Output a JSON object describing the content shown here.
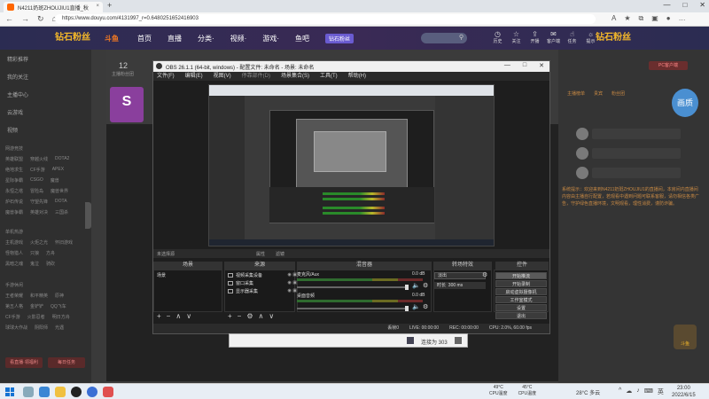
{
  "browser": {
    "tab_title": "N4211奶斑ZHOUJIU1直播_秋",
    "new_tab": "+",
    "window_controls": [
      "—",
      "□",
      "✕"
    ],
    "url": "https://www.douyu.com/4131997_r=0.6480251652416903",
    "nav_icons": [
      "back-icon",
      "forward-icon",
      "refresh-icon",
      "home-icon"
    ],
    "tool_icons": [
      "read-aloud-icon",
      "favorite-icon",
      "extensions-icon",
      "collections-icon",
      "profile-icon",
      "menu-icon"
    ]
  },
  "site": {
    "logo": "钻石粉丝",
    "logo_sub": "斗鱼",
    "nav": [
      "首页",
      "直播",
      "分类·",
      "视频·",
      "游戏·",
      "鱼吧",
      "钻石粉丝",
      "可爆宝石"
    ],
    "header_icons": [
      {
        "icon": "clock-icon",
        "label": "历史"
      },
      {
        "icon": "star-icon",
        "label": "关注"
      },
      {
        "icon": "upload-icon",
        "label": "开播"
      },
      {
        "icon": "mail-icon",
        "label": "客户端"
      },
      {
        "icon": "hand-icon",
        "label": "任务"
      },
      {
        "icon": "bulb-icon",
        "label": "提示"
      }
    ],
    "logo_right": "钻石粉丝"
  },
  "sidebar": {
    "items": [
      "精彩推荐",
      "我的关注",
      "主播中心",
      "云游戏",
      "视频"
    ],
    "group1_title": "网游竞技",
    "group1_rows": [
      [
        "英雄联盟",
        "穿越火线",
        "DOTA2"
      ],
      [
        "绝地求生",
        "CF手游",
        "APEX"
      ],
      [
        "星际争霸",
        "CSGO",
        "魔兽"
      ],
      [
        "永恒之塔",
        "冒险岛",
        "魔兽世界"
      ],
      [
        "炉石传说",
        "守望先锋",
        "DOTA"
      ],
      [
        "魔兽争霸",
        "英雄对决",
        "三国杀"
      ]
    ],
    "group2_title": "单机热游",
    "group2_rows": [
      [
        "主机游戏",
        "火炬之光",
        "怀旧游戏"
      ],
      [
        "怪物猎人",
        "只狼",
        "方舟"
      ],
      [
        "黑暗之魂",
        "鬼泣",
        "骑砍"
      ]
    ],
    "group3_title": "手游休闲",
    "group3_rows": [
      [
        "王者荣耀",
        "和平精英",
        "原神"
      ],
      [
        "第五人格",
        "金铲铲",
        "QQ飞车"
      ],
      [
        "CF手游",
        "火影忍者",
        "明日方舟"
      ],
      [
        "球球大作战",
        "阴阳师",
        "光遇"
      ]
    ],
    "btn_left": "看直播·领福利",
    "btn_right": "每日任务"
  },
  "stream": {
    "count": "12",
    "count_label": "主播粉丝团"
  },
  "right_panel": {
    "top_button": "PC客户端",
    "tabs": [
      "主播榜单",
      "贵宾",
      "粉丝团"
    ],
    "bird": "画质",
    "notice": "系统提示：欢迎来到N4211奶斑ZHOUJIU1的直播间，本房间内直播间内容由主播自行配置，若观看中遇到问题可联系客服，请勿相信各类广告，守护绿色直播环境，文明观看，理性消费，谨防诈骗。",
    "mascot": "斗鱼"
  },
  "obs": {
    "title": "OBS 26.1.1 (64-bit, windows) - 配置文件: 未命名 - 场景: 未命名",
    "menu": [
      "文件(F)",
      "编辑(E)",
      "视图(V)",
      "停靠部件(D)",
      "场景集合(S)",
      "工具(T)",
      "帮助(H)"
    ],
    "no_source": "未选择源",
    "properties": "属性",
    "filters": "滤镜",
    "docks": {
      "scenes": "场景",
      "sources": "来源",
      "mixer": "混音器",
      "transitions": "转场特效",
      "controls": "控件"
    },
    "scene_item": "场景",
    "sources": [
      "视频采集设备",
      "窗口采集",
      "显示器采集"
    ],
    "mixer": [
      {
        "name": "麦克风/Aux",
        "db": "0.0 dB",
        "level": 0.0
      },
      {
        "name": "桌面音频",
        "db": "0.0 dB",
        "level": 0.0
      }
    ],
    "transition": "淡出",
    "duration_label": "时长",
    "duration": "300 ms",
    "controls": [
      "开始推流",
      "开始录制",
      "启动虚拟摄像机",
      "工作室模式",
      "设置",
      "退出"
    ],
    "status": [
      "LIVE: 00:00:00",
      "REC: 00:00:00",
      "CPU: 2.0%, 60.00 fps"
    ],
    "dropped": "丢帧0",
    "footer_icons": [
      "+",
      "−",
      "∧",
      "∨"
    ]
  },
  "strip": {
    "label": "连接为 303"
  },
  "taskbar": {
    "temps": [
      {
        "v": "49°C",
        "l": "CPU温度"
      },
      {
        "v": "45°C",
        "l": "CPU温度"
      }
    ],
    "weather": "28°C 多云",
    "tray": [
      "^",
      "☁",
      "♪",
      "⌨",
      "英"
    ],
    "time": "23:00",
    "date": "2022/6/15"
  }
}
